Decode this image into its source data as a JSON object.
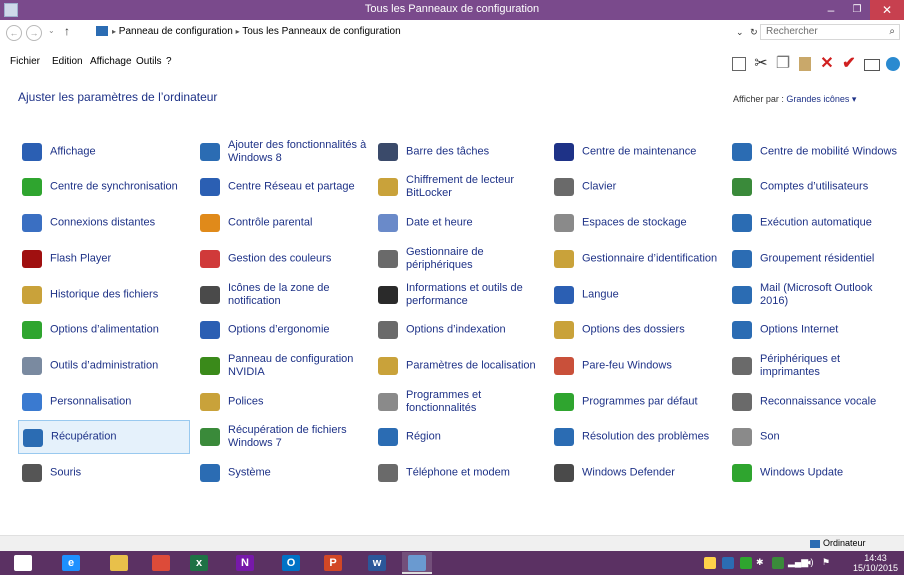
{
  "window": {
    "title": "Tous les Panneaux de configuration",
    "minimize": "–",
    "maximize": "❐",
    "close": "✕"
  },
  "address": {
    "back": "←",
    "forward": "→",
    "dropdown": "⌄",
    "up": "↑",
    "crumbs": [
      "Panneau de configuration",
      "Tous les Panneaux de configuration"
    ],
    "separator": "▸",
    "expand": "⌄",
    "refresh": "↻",
    "search_placeholder": "Rechercher"
  },
  "menu": [
    "Fichier",
    "Edition",
    "Affichage",
    "Outils",
    "?"
  ],
  "toolbar_icons": [
    "square-icon",
    "cut-icon",
    "copy-icon",
    "paste-icon",
    "delete-icon",
    "check-icon",
    "rename-icon",
    "globe-icon"
  ],
  "header": {
    "title": "Ajuster les paramètres de l’ordinateur",
    "view_label": "Afficher par :",
    "view_value": "Grandes icônes"
  },
  "items": [
    [
      {
        "label": "Affichage",
        "color": "#2b5fb3",
        "icon": "display-icon"
      },
      {
        "label": "Centre de synchronisation",
        "color": "#2fa52f",
        "icon": "sync-icon"
      },
      {
        "label": "Connexions distantes",
        "color": "#3a6fc2",
        "icon": "remote-icon"
      },
      {
        "label": "Flash Player",
        "color": "#a01010",
        "icon": "flash-icon"
      },
      {
        "label": "Historique des fichiers",
        "color": "#c9a23a",
        "icon": "history-icon"
      },
      {
        "label": "Options d’alimentation",
        "color": "#2fa52f",
        "icon": "power-icon"
      },
      {
        "label": "Outils d’administration",
        "color": "#7a8aa0",
        "icon": "admin-icon"
      },
      {
        "label": "Personnalisation",
        "color": "#3a7ad0",
        "icon": "personalize-icon"
      },
      {
        "label": "Récupération",
        "color": "#2b6cb3",
        "icon": "recovery-icon"
      },
      {
        "label": "Souris",
        "color": "#555555",
        "icon": "mouse-icon"
      }
    ],
    [
      {
        "label": "Ajouter des fonctionnalités à Windows 8",
        "color": "#2b6cb3",
        "icon": "add-features-icon"
      },
      {
        "label": "Centre Réseau et partage",
        "color": "#2b5fb3",
        "icon": "network-icon"
      },
      {
        "label": "Contrôle parental",
        "color": "#e08a1a",
        "icon": "parental-icon"
      },
      {
        "label": "Gestion des couleurs",
        "color": "#d03a3a",
        "icon": "color-icon"
      },
      {
        "label": "Icônes de la zone de notification",
        "color": "#4a4a4a",
        "icon": "notification-icon"
      },
      {
        "label": "Options d’ergonomie",
        "color": "#2b5fb3",
        "icon": "ergonomics-icon"
      },
      {
        "label": "Panneau de configuration NVIDIA",
        "color": "#3a8a1a",
        "icon": "nvidia-icon"
      },
      {
        "label": "Polices",
        "color": "#c9a23a",
        "icon": "fonts-icon"
      },
      {
        "label": "Récupération de fichiers Windows 7",
        "color": "#3a8a3a",
        "icon": "file-recovery-icon"
      },
      {
        "label": "Système",
        "color": "#2b6cb3",
        "icon": "system-icon"
      }
    ],
    [
      {
        "label": "Barre des tâches",
        "color": "#3a4a6a",
        "icon": "taskbar-icon"
      },
      {
        "label": "Chiffrement de lecteur BitLocker",
        "color": "#c9a23a",
        "icon": "bitlocker-icon"
      },
      {
        "label": "Date et heure",
        "color": "#6a8ac9",
        "icon": "datetime-icon"
      },
      {
        "label": "Gestionnaire de périphériques",
        "color": "#6a6a6a",
        "icon": "device-manager-icon"
      },
      {
        "label": "Informations et outils de performance",
        "color": "#2a2a2a",
        "icon": "performance-icon"
      },
      {
        "label": "Options d’indexation",
        "color": "#6a6a6a",
        "icon": "indexing-icon"
      },
      {
        "label": "Paramètres de localisation",
        "color": "#c9a23a",
        "icon": "location-icon"
      },
      {
        "label": "Programmes et fonctionnalités",
        "color": "#8a8a8a",
        "icon": "programs-icon"
      },
      {
        "label": "Région",
        "color": "#2b6cb3",
        "icon": "region-icon"
      },
      {
        "label": "Téléphone et modem",
        "color": "#6a6a6a",
        "icon": "phone-icon"
      }
    ],
    [
      {
        "label": "Centre de maintenance",
        "color": "#1e3287",
        "icon": "flag-icon"
      },
      {
        "label": "Clavier",
        "color": "#6a6a6a",
        "icon": "keyboard-icon"
      },
      {
        "label": "Espaces de stockage",
        "color": "#8a8a8a",
        "icon": "storage-icon"
      },
      {
        "label": "Gestionnaire d’identification",
        "color": "#c9a23a",
        "icon": "credential-icon"
      },
      {
        "label": "Langue",
        "color": "#2b5fb3",
        "icon": "language-icon"
      },
      {
        "label": "Options des dossiers",
        "color": "#c9a23a",
        "icon": "folder-options-icon"
      },
      {
        "label": "Pare-feu Windows",
        "color": "#c9503a",
        "icon": "firewall-icon"
      },
      {
        "label": "Programmes par défaut",
        "color": "#2fa52f",
        "icon": "default-programs-icon"
      },
      {
        "label": "Résolution des problèmes",
        "color": "#2b6cb3",
        "icon": "troubleshoot-icon"
      },
      {
        "label": "Windows Defender",
        "color": "#4a4a4a",
        "icon": "defender-icon"
      }
    ],
    [
      {
        "label": "Centre de mobilité Windows",
        "color": "#2b6cb3",
        "icon": "mobility-icon"
      },
      {
        "label": "Comptes d’utilisateurs",
        "color": "#3a8a3a",
        "icon": "users-icon"
      },
      {
        "label": "Exécution automatique",
        "color": "#2b6cb3",
        "icon": "autoplay-icon"
      },
      {
        "label": "Groupement résidentiel",
        "color": "#2b6cb3",
        "icon": "homegroup-icon"
      },
      {
        "label": "Mail (Microsoft Outlook 2016)",
        "color": "#2b6cb3",
        "icon": "mail-icon"
      },
      {
        "label": "Options Internet",
        "color": "#2b6cb3",
        "icon": "internet-options-icon"
      },
      {
        "label": "Périphériques et imprimantes",
        "color": "#6a6a6a",
        "icon": "printers-icon"
      },
      {
        "label": "Reconnaissance vocale",
        "color": "#6a6a6a",
        "icon": "microphone-icon"
      },
      {
        "label": "Son",
        "color": "#8a8a8a",
        "icon": "sound-icon"
      },
      {
        "label": "Windows Update",
        "color": "#2fa52f",
        "icon": "update-icon"
      }
    ]
  ],
  "status": {
    "label": "Ordinateur"
  },
  "taskbar": {
    "apps": [
      {
        "name": "windows-start-button",
        "glyph": "⊞",
        "color": "#ffffff"
      },
      {
        "name": "internet-explorer-icon",
        "glyph": "e",
        "color": "#1e90ff"
      },
      {
        "name": "file-explorer-icon",
        "glyph": "",
        "color": "#e8c04a"
      },
      {
        "name": "chrome-icon",
        "glyph": "",
        "color": "#dd4b39"
      },
      {
        "name": "excel-icon",
        "glyph": "x",
        "color": "#1e7145"
      },
      {
        "name": "onenote-icon",
        "glyph": "N",
        "color": "#7719aa"
      },
      {
        "name": "outlook-icon",
        "glyph": "O",
        "color": "#0072c6"
      },
      {
        "name": "powerpoint-icon",
        "glyph": "P",
        "color": "#d24726"
      },
      {
        "name": "word-icon",
        "glyph": "w",
        "color": "#2b579a"
      },
      {
        "name": "control-panel-icon",
        "glyph": "",
        "color": "#6a9ad0"
      }
    ],
    "time": "14:43",
    "date": "15/10/2015"
  }
}
